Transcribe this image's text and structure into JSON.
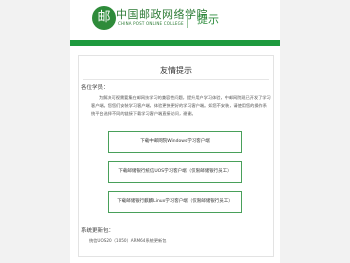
{
  "header": {
    "logo_cn": "中国邮政网络学院",
    "logo_en": "CHINA POST ONLINE COLLEGE",
    "logo_mark": "邮",
    "title": "提示"
  },
  "card": {
    "title": "友情提示",
    "salute": "各位学员：",
    "intro": "为解决可视需要集在邮网技学习的兼容性问题，提升用户学习体验，中邮网院现已开发了学习客户端。您您们安装学习客户端，体验更快更好的学习客户端。如您不安装，请使用您的操作系统平台选择不同的链接下载学习客户端直接访问，谢谢。",
    "buttons": [
      {
        "label": "下载中邮网院Windows学习客户端"
      },
      {
        "label": "下载邮储银行统信UOS学习客户端（仅限邮储银行员工）"
      },
      {
        "label": "下载邮储银行麒麟Linux学习客户端（仅限邮储银行员工）"
      }
    ],
    "system_title": "系统更新包：",
    "system_item": "统信UOS20（1050）ARM64系统更新包"
  },
  "colors": {
    "brand_green": "#1e9a3e",
    "logo_green": "#2c7a35"
  }
}
